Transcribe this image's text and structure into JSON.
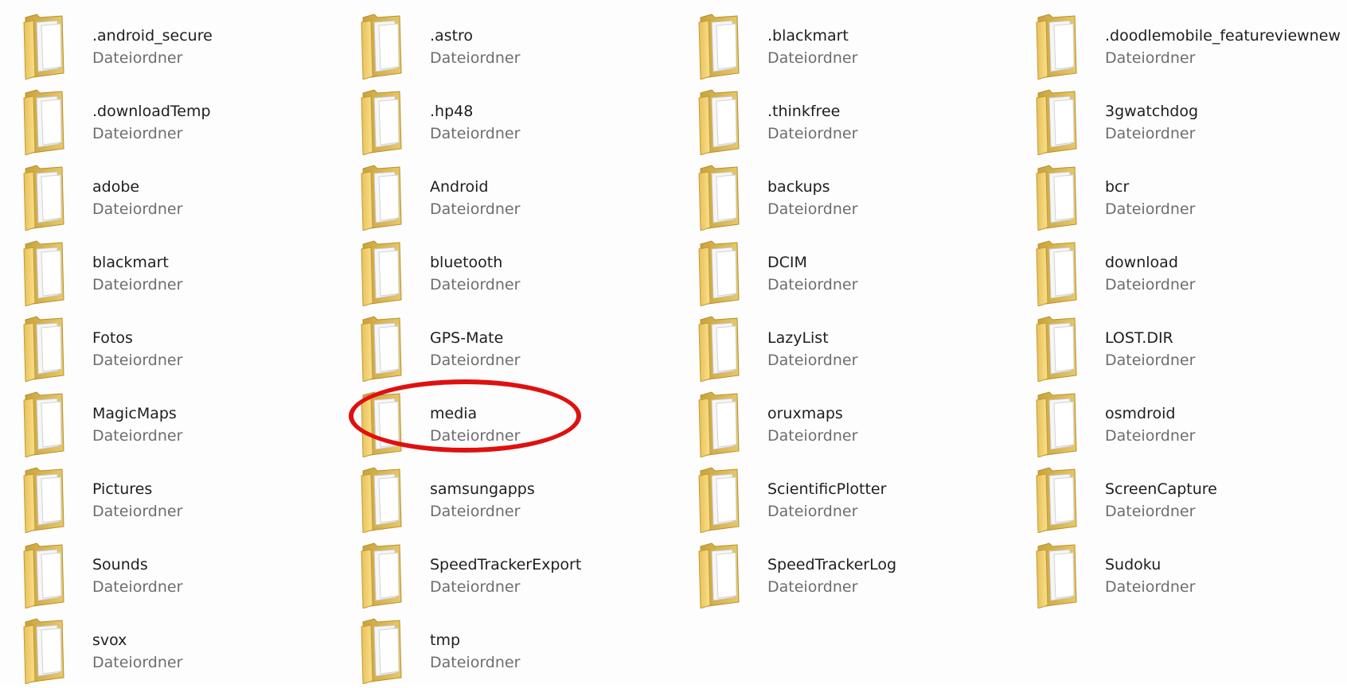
{
  "folders": [
    {
      "name": ".android_secure",
      "type": "Dateiordner"
    },
    {
      "name": ".astro",
      "type": "Dateiordner"
    },
    {
      "name": ".blackmart",
      "type": "Dateiordner"
    },
    {
      "name": ".doodlemobile_featureviewnew",
      "type": "Dateiordner"
    },
    {
      "name": ".downloadTemp",
      "type": "Dateiordner"
    },
    {
      "name": ".hp48",
      "type": "Dateiordner"
    },
    {
      "name": ".thinkfree",
      "type": "Dateiordner"
    },
    {
      "name": "3gwatchdog",
      "type": "Dateiordner"
    },
    {
      "name": "adobe",
      "type": "Dateiordner"
    },
    {
      "name": "Android",
      "type": "Dateiordner"
    },
    {
      "name": "backups",
      "type": "Dateiordner"
    },
    {
      "name": "bcr",
      "type": "Dateiordner"
    },
    {
      "name": "blackmart",
      "type": "Dateiordner"
    },
    {
      "name": "bluetooth",
      "type": "Dateiordner"
    },
    {
      "name": "DCIM",
      "type": "Dateiordner"
    },
    {
      "name": "download",
      "type": "Dateiordner"
    },
    {
      "name": "Fotos",
      "type": "Dateiordner"
    },
    {
      "name": "GPS-Mate",
      "type": "Dateiordner"
    },
    {
      "name": "LazyList",
      "type": "Dateiordner"
    },
    {
      "name": "LOST.DIR",
      "type": "Dateiordner"
    },
    {
      "name": "MagicMaps",
      "type": "Dateiordner"
    },
    {
      "name": "media",
      "type": "Dateiordner"
    },
    {
      "name": "oruxmaps",
      "type": "Dateiordner"
    },
    {
      "name": "osmdroid",
      "type": "Dateiordner"
    },
    {
      "name": "Pictures",
      "type": "Dateiordner"
    },
    {
      "name": "samsungapps",
      "type": "Dateiordner"
    },
    {
      "name": "ScientificPlotter",
      "type": "Dateiordner"
    },
    {
      "name": "ScreenCapture",
      "type": "Dateiordner"
    },
    {
      "name": "Sounds",
      "type": "Dateiordner"
    },
    {
      "name": "SpeedTrackerExport",
      "type": "Dateiordner"
    },
    {
      "name": "SpeedTrackerLog",
      "type": "Dateiordner"
    },
    {
      "name": "Sudoku",
      "type": "Dateiordner"
    },
    {
      "name": "svox",
      "type": "Dateiordner"
    },
    {
      "name": "tmp",
      "type": "Dateiordner"
    }
  ],
  "icon": "folder-icon",
  "colors": {
    "folder_back": "#d9b14a",
    "folder_front": "#f4d777",
    "paper": "#f7f7f7",
    "highlight": "#e01010"
  }
}
